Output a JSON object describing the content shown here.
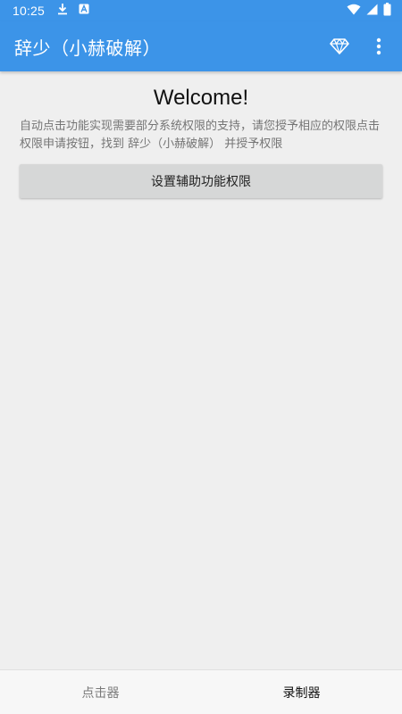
{
  "status_bar": {
    "time": "10:25",
    "left_icons": [
      "download-icon",
      "notification-a-icon"
    ],
    "right_icons": [
      "wifi-icon",
      "signal-icon",
      "battery-icon"
    ]
  },
  "app_bar": {
    "title": "辞少（小赫破解）",
    "background_color": "#3c94e8",
    "actions": [
      "diamond-icon",
      "more-vert-icon"
    ]
  },
  "main": {
    "welcome": "Welcome!",
    "description": "自动点击功能实现需要部分系统权限的支持，请您授予相应的权限点击权限申请按钮，找到 辞少（小赫破解） 并授予权限",
    "button_label": "设置辅助功能权限"
  },
  "bottom_nav": {
    "tabs": [
      {
        "label": "点击器",
        "active": false
      },
      {
        "label": "录制器",
        "active": true
      }
    ]
  }
}
